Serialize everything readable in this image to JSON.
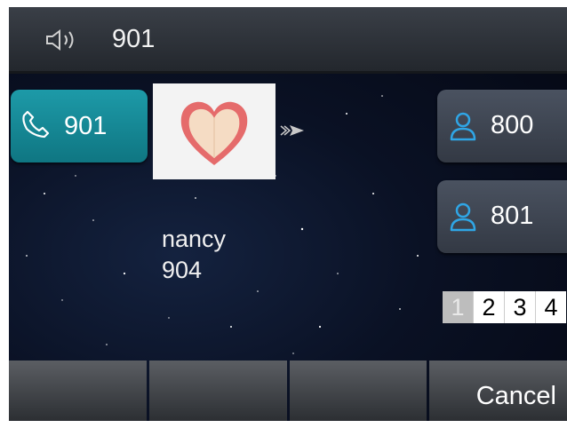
{
  "status_bar": {
    "volume_icon": "speaker-icon",
    "title": "901"
  },
  "line_key": {
    "icon": "phone-handset-icon",
    "label": "901",
    "color": "#168a96"
  },
  "caller": {
    "avatar_icon": "heart-avatar-icon",
    "name": "nancy",
    "number": "904"
  },
  "contacts": [
    {
      "icon": "person-icon",
      "label": "800"
    },
    {
      "icon": "person-icon",
      "label": "801"
    }
  ],
  "pager": {
    "pages": [
      "1",
      "2",
      "3",
      "4"
    ],
    "current": "1"
  },
  "softkeys": [
    {
      "label": ""
    },
    {
      "label": ""
    },
    {
      "label": ""
    },
    {
      "label": "Cancel"
    }
  ]
}
